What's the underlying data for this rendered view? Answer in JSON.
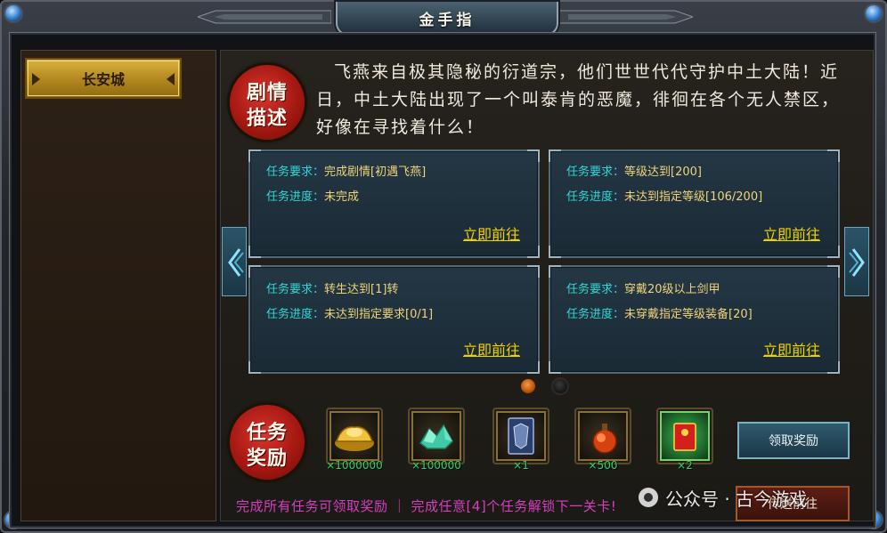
{
  "window": {
    "title": "金手指"
  },
  "sidebar": {
    "items": [
      {
        "label": "长安城"
      }
    ]
  },
  "story": {
    "badge_line1": "剧情",
    "badge_line2": "描述",
    "text": "飞燕来自极其隐秘的衍道宗，他们世世代代守护中土大陆！近日，中土大陆出现了一个叫泰肯的恶魔，徘徊在各个无人禁区，好像在寻找着什么！"
  },
  "tasks": [
    {
      "req_key": "任务要求：",
      "req": "完成剧情[初遇飞燕]",
      "prog_key": "任务进度：",
      "prog": "未完成",
      "go": "立即前往"
    },
    {
      "req_key": "任务要求：",
      "req": "等级达到[200]",
      "prog_key": "任务进度：",
      "prog": "未达到指定等级[106/200]",
      "go": "立即前往"
    },
    {
      "req_key": "任务要求：",
      "req": "转生达到[1]转",
      "prog_key": "任务进度：",
      "prog": "未达到指定要求[0/1]",
      "go": "立即前往"
    },
    {
      "req_key": "任务要求：",
      "req": "穿戴20级以上剑甲",
      "prog_key": "任务进度：",
      "prog": "未穿戴指定等级装备[20]",
      "go": "立即前往"
    }
  ],
  "pager": {
    "current": 1,
    "total": 2
  },
  "rewards": {
    "badge_line1": "任务",
    "badge_line2": "奖励",
    "items": [
      {
        "icon": "gold-ingot-icon",
        "qty": "×1000000"
      },
      {
        "icon": "jade-crystal-icon",
        "qty": "×100000"
      },
      {
        "icon": "armor-card-icon",
        "qty": "×1"
      },
      {
        "icon": "gourd-potion-icon",
        "qty": "×500"
      },
      {
        "icon": "red-envelope-icon",
        "qty": "×2"
      }
    ],
    "claim_label": "领取奖励"
  },
  "footer": {
    "text": "完成所有任务可领取奖励 ｜ 完成任意[4]个任务解锁下一关卡!",
    "send_label": "传送前往"
  },
  "watermark": {
    "text": "公众号 · 古今游戏"
  },
  "colors": {
    "task_key": "#33d6d6",
    "task_value": "#f0d37a",
    "link": "#f1d000",
    "footer": "#d63fbd",
    "reward_qty": "#2fd26a"
  }
}
